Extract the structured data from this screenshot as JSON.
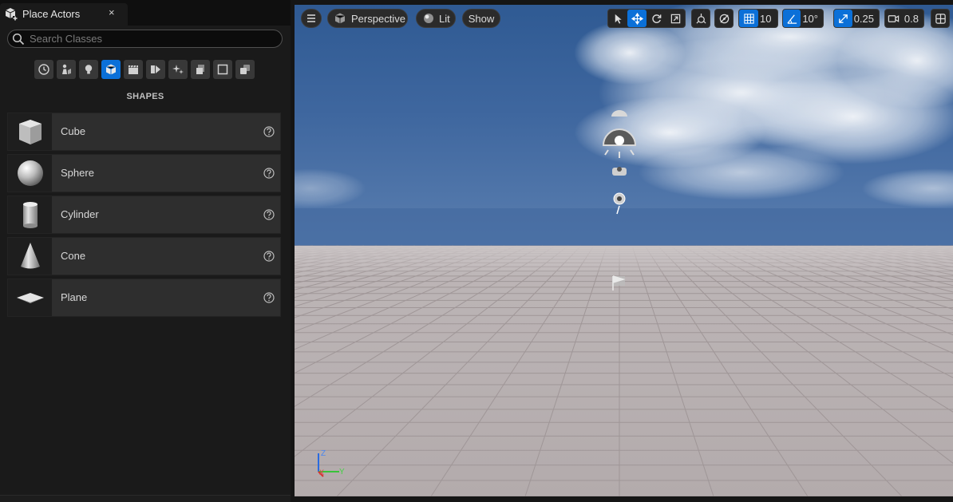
{
  "panel": {
    "tab_title": "Place Actors",
    "close_glyph": "×",
    "search_placeholder": "Search Classes",
    "categories": [
      {
        "name": "recently-placed",
        "icon": "clock-icon"
      },
      {
        "name": "basic",
        "icon": "actor-icon"
      },
      {
        "name": "lights",
        "icon": "lightbulb-icon"
      },
      {
        "name": "shapes",
        "icon": "cube-icon",
        "active": true
      },
      {
        "name": "cinematic",
        "icon": "clapperboard-icon"
      },
      {
        "name": "visual-effects",
        "icon": "play-box-icon"
      },
      {
        "name": "geometry",
        "icon": "sparkle-icon"
      },
      {
        "name": "volumes",
        "icon": "volumes-icon"
      },
      {
        "name": "all-classes",
        "icon": "square-icon"
      },
      {
        "name": "misc",
        "icon": "stack-icon"
      }
    ],
    "section_title": "SHAPES",
    "items": [
      {
        "label": "Cube",
        "icon": "cube-thumbnail"
      },
      {
        "label": "Sphere",
        "icon": "sphere-thumbnail"
      },
      {
        "label": "Cylinder",
        "icon": "cylinder-thumbnail"
      },
      {
        "label": "Cone",
        "icon": "cone-thumbnail"
      },
      {
        "label": "Plane",
        "icon": "plane-thumbnail"
      }
    ]
  },
  "viewport": {
    "view_mode": "Perspective",
    "lighting_mode": "Lit",
    "show_label": "Show",
    "grid_snap": "10",
    "rotation_snap": "10°",
    "scale_snap": "0.25",
    "camera_speed": "0.8",
    "axis_labels": {
      "z": "Z",
      "x": "X",
      "y": "Y"
    }
  },
  "colors": {
    "accent": "#0b70d8",
    "panel_bg": "#1a1a1a",
    "row_bg": "#2e2e2e",
    "sky_top": "#2f5a93",
    "sky_horizon": "#4c72a6",
    "floor_light": "#c3bcbc",
    "floor_dark": "#a9a0a0"
  }
}
